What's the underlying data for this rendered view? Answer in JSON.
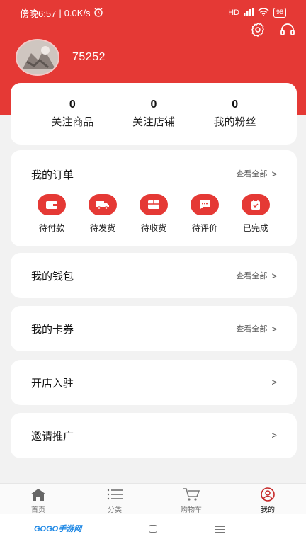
{
  "status": {
    "time": "傍晚6:57",
    "speed": "0.0K/s",
    "network": "HD",
    "battery": "98"
  },
  "profile": {
    "username": "75252"
  },
  "stats": [
    {
      "value": "0",
      "label": "关注商品"
    },
    {
      "value": "0",
      "label": "关注店铺"
    },
    {
      "value": "0",
      "label": "我的粉丝"
    }
  ],
  "orders": {
    "title": "我的订单",
    "more": "查看全部",
    "items": [
      {
        "label": "待付款",
        "icon": "wallet-icon"
      },
      {
        "label": "待发货",
        "icon": "truck-icon"
      },
      {
        "label": "待收货",
        "icon": "box-icon"
      },
      {
        "label": "待评价",
        "icon": "chat-icon"
      },
      {
        "label": "已完成",
        "icon": "check-bag-icon"
      }
    ]
  },
  "wallet": {
    "title": "我的钱包",
    "more": "查看全部"
  },
  "coupons": {
    "title": "我的卡券",
    "more": "查看全部"
  },
  "open_store": {
    "title": "开店入驻"
  },
  "invite": {
    "title": "邀请推广"
  },
  "nav": [
    {
      "label": "首页",
      "icon": "home-icon"
    },
    {
      "label": "分类",
      "icon": "list-icon"
    },
    {
      "label": "购物车",
      "icon": "cart-icon"
    },
    {
      "label": "我的",
      "icon": "profile-icon",
      "active": true
    }
  ],
  "watermark": "GOGO手游网",
  "colors": {
    "accent": "#e53935",
    "background": "#f2f2f2"
  }
}
